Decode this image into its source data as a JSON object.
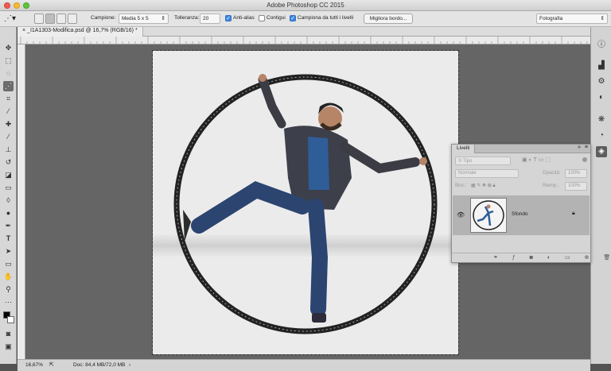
{
  "window": {
    "title": "Adobe Photoshop CC 2015"
  },
  "options_bar": {
    "sample_label": "Campione:",
    "sample_value": "Media 5 x 5",
    "tolerance_label": "Tolleranza:",
    "tolerance_value": "20",
    "antialias_label": "Anti-alias",
    "contiguous_label": "Contigui",
    "sample_all_label": "Campiona da tutti i livelli",
    "refine_edge_button": "Migliora bordo...",
    "workspace_value": "Fotografia"
  },
  "document": {
    "tab_title": "_I1A1303-Modifica.psd @ 16,7% (RGB/16) *",
    "zoom": "16,67%",
    "doc_info": "Doc: 84,4 MB/72,0 MB"
  },
  "layers_panel": {
    "title": "Livelli",
    "filter_placeholder": "Tipo",
    "blend_mode": "Normale",
    "opacity_label": "Opacità:",
    "opacity_value": "100%",
    "lock_label": "Bloc.:",
    "fill_label": "Riemp.:",
    "fill_value": "100%",
    "layer_name": "Sfondo"
  },
  "colors": {
    "accent": "#3b87e0",
    "foreground": "#000000",
    "background": "#ffffff"
  }
}
